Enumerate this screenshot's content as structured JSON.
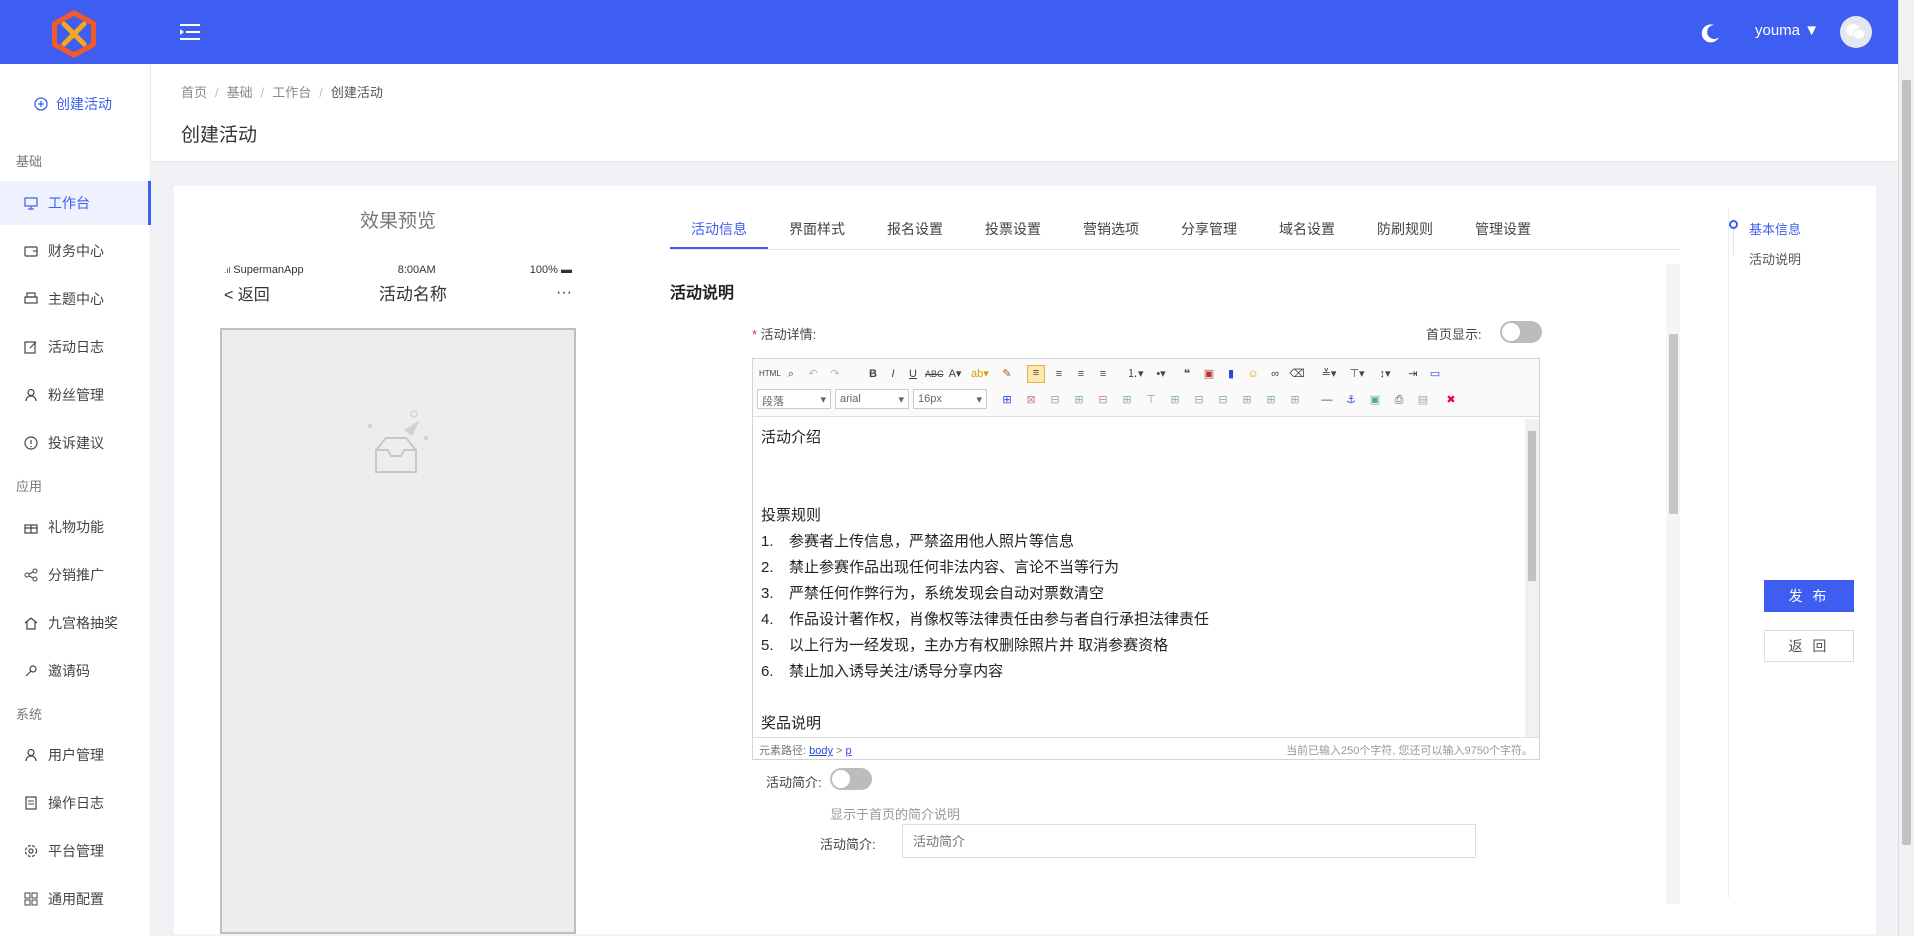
{
  "header": {
    "user": "youma"
  },
  "sidebar": {
    "create": "创建活动",
    "sections": [
      "基础",
      "应用",
      "系统"
    ],
    "items": [
      {
        "label": "工作台",
        "icon": "monitor-icon"
      },
      {
        "label": "财务中心",
        "icon": "wallet-icon"
      },
      {
        "label": "主题中心",
        "icon": "printer-icon"
      },
      {
        "label": "活动日志",
        "icon": "edit-icon"
      },
      {
        "label": "粉丝管理",
        "icon": "user-icon"
      },
      {
        "label": "投诉建议",
        "icon": "info-icon"
      },
      {
        "label": "礼物功能",
        "icon": "gift-icon"
      },
      {
        "label": "分销推广",
        "icon": "share-icon"
      },
      {
        "label": "九宫格抽奖",
        "icon": "home-icon"
      },
      {
        "label": "邀请码",
        "icon": "key-icon"
      },
      {
        "label": "用户管理",
        "icon": "user-icon"
      },
      {
        "label": "操作日志",
        "icon": "log-icon"
      },
      {
        "label": "平台管理",
        "icon": "settings-icon"
      },
      {
        "label": "通用配置",
        "icon": "grid-icon"
      }
    ]
  },
  "breadcrumb": [
    "首页",
    "基础",
    "工作台",
    "创建活动"
  ],
  "page_title": "创建活动",
  "preview": {
    "title": "效果预览",
    "carrier": "SupermanApp",
    "time": "8:00AM",
    "battery": "100%",
    "back": "返回",
    "name": "活动名称",
    "more": "···"
  },
  "tabs": [
    "活动信息",
    "界面样式",
    "报名设置",
    "投票设置",
    "营销选项",
    "分享管理",
    "域名设置",
    "防刷规则",
    "管理设置"
  ],
  "form": {
    "section_title": "活动说明",
    "detail_label": "活动详情:",
    "home_label": "首页显示:",
    "editor": {
      "paragraph_select": "段落",
      "font_select": "arial",
      "size_select": "16px",
      "body": {
        "intro": "活动介绍",
        "rules_title": "投票规则",
        "rules": [
          "参赛者上传信息，严禁盗用他人照片等信息",
          "禁止参赛作品出现任何非法内容、言论不当等行为",
          "严禁任何作弊行为，系统发现会自动对票数清空",
          "作品设计著作权，肖像权等法律责任由参与者自行承担法律责任",
          "以上行为一经发现，主办方有权删除照片并 取消参赛资格",
          "禁止加入诱导关注/诱导分享内容"
        ],
        "prize_title": "奖品说明"
      },
      "footer_path_label": "元素路径:",
      "footer_path_body": "body",
      "footer_path_p": "p",
      "footer_count": "当前已输入250个字符, 您还可以输入9750个字符。"
    },
    "brief_toggle_label": "活动简介:",
    "brief_hint": "显示于首页的简介说明",
    "brief_label": "活动简介:",
    "brief_placeholder": "活动简介"
  },
  "anchor": [
    "基本信息",
    "活动说明"
  ],
  "actions": {
    "publish": "发 布",
    "back": "返 回"
  },
  "colors": {
    "primary": "#3d5ef0"
  }
}
